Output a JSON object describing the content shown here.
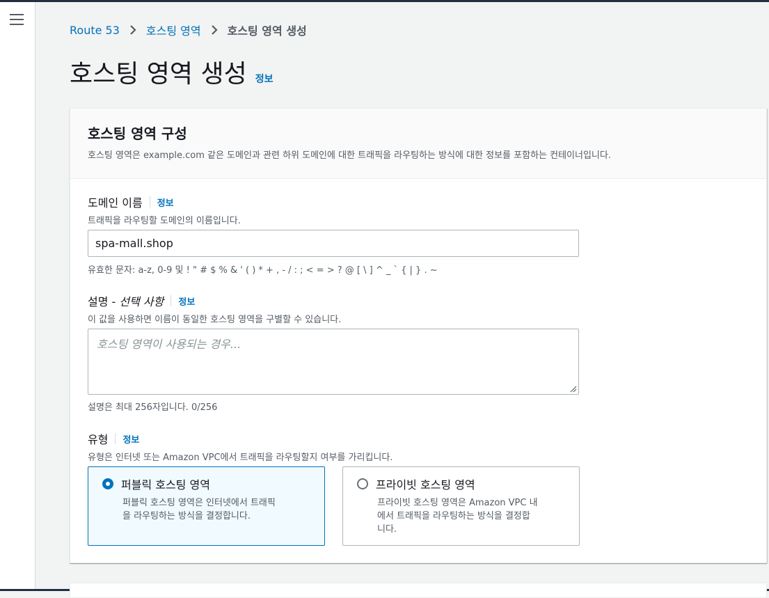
{
  "breadcrumb": {
    "items": [
      "Route 53",
      "호스팅 영역"
    ],
    "current": "호스팅 영역 생성"
  },
  "page": {
    "title": "호스팅 영역 생성",
    "info": "정보"
  },
  "section": {
    "title": "호스팅 영역 구성",
    "description": "호스팅 영역은 example.com 같은 도메인과 관련 하위 도메인에 대한 트래픽을 라우팅하는 방식에 대한 정보를 포함하는 컨테이너입니다."
  },
  "domain_field": {
    "label": "도메인 이름",
    "info": "정보",
    "description": "트래픽을 라우팅할 도메인의 이름입니다.",
    "value": "spa-mall.shop",
    "hint": "유효한 문자: a-z, 0-9 및 ! \" # $ % & ' ( ) * + , - / : ; < = > ? @ [ \\ ] ^ _ ` { | } . ~"
  },
  "description_field": {
    "label": "설명 - ",
    "label_optional": "선택 사항",
    "info": "정보",
    "description": "이 값을 사용하면 이름이 동일한 호스팅 영역을 구별할 수 있습니다.",
    "placeholder": "호스팅 영역이 사용되는 경우...",
    "hint": "설명은 최대 256자입니다. 0/256"
  },
  "type_field": {
    "label": "유형",
    "info": "정보",
    "description": "유형은 인터넷 또는 Amazon VPC에서 트래픽을 라우팅할지 여부를 가리킵니다.",
    "options": [
      {
        "label": "퍼블릭 호스팅 영역",
        "description_line1": "퍼블릭 호스팅 영역은 인터넷에서 트래픽",
        "description_line2": "을 라우팅하는 방식을 결정합니다.",
        "selected": true
      },
      {
        "label": "프라이빗 호스팅 영역",
        "description_line1": "프라이빗 호스팅 영역은 Amazon VPC 내",
        "description_line2": "에서 트래픽을 라우팅하는 방식을 결정합",
        "description_line3": "니다.",
        "selected": false
      }
    ]
  },
  "colors": {
    "link": "#0073bb",
    "selected_border": "#0073bb",
    "selected_bg": "#f1faff",
    "header_bar": "#232f3e"
  }
}
